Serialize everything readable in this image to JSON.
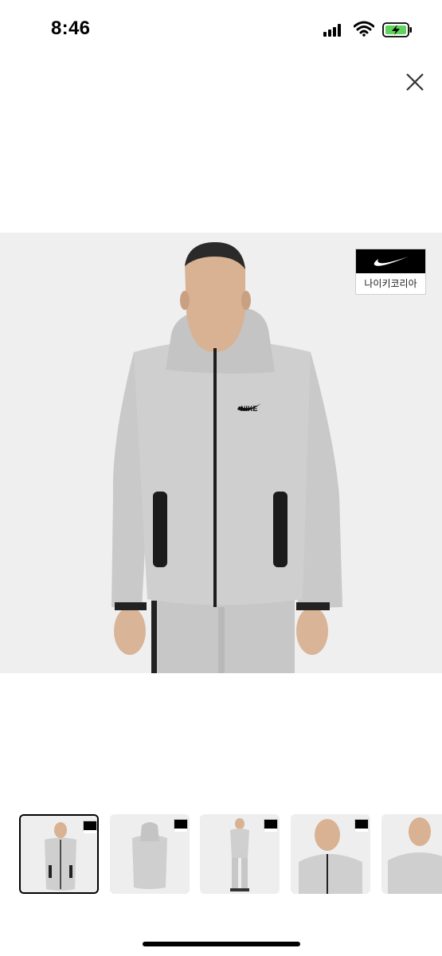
{
  "status_bar": {
    "time": "8:46",
    "icons": [
      "cellular-signal-icon",
      "wifi-icon",
      "battery-charging-icon"
    ],
    "battery_color": "#5fd35a"
  },
  "close_icon": "close-icon",
  "main_image": {
    "badge_text": "나이키코리아",
    "background": "#efefef",
    "garment_color": "#cfcfcf"
  },
  "thumbnails": {
    "count": 5,
    "selected_index": 0,
    "items": [
      "front-view",
      "back-view",
      "full-body-view",
      "closeup-view",
      "side-view"
    ]
  }
}
